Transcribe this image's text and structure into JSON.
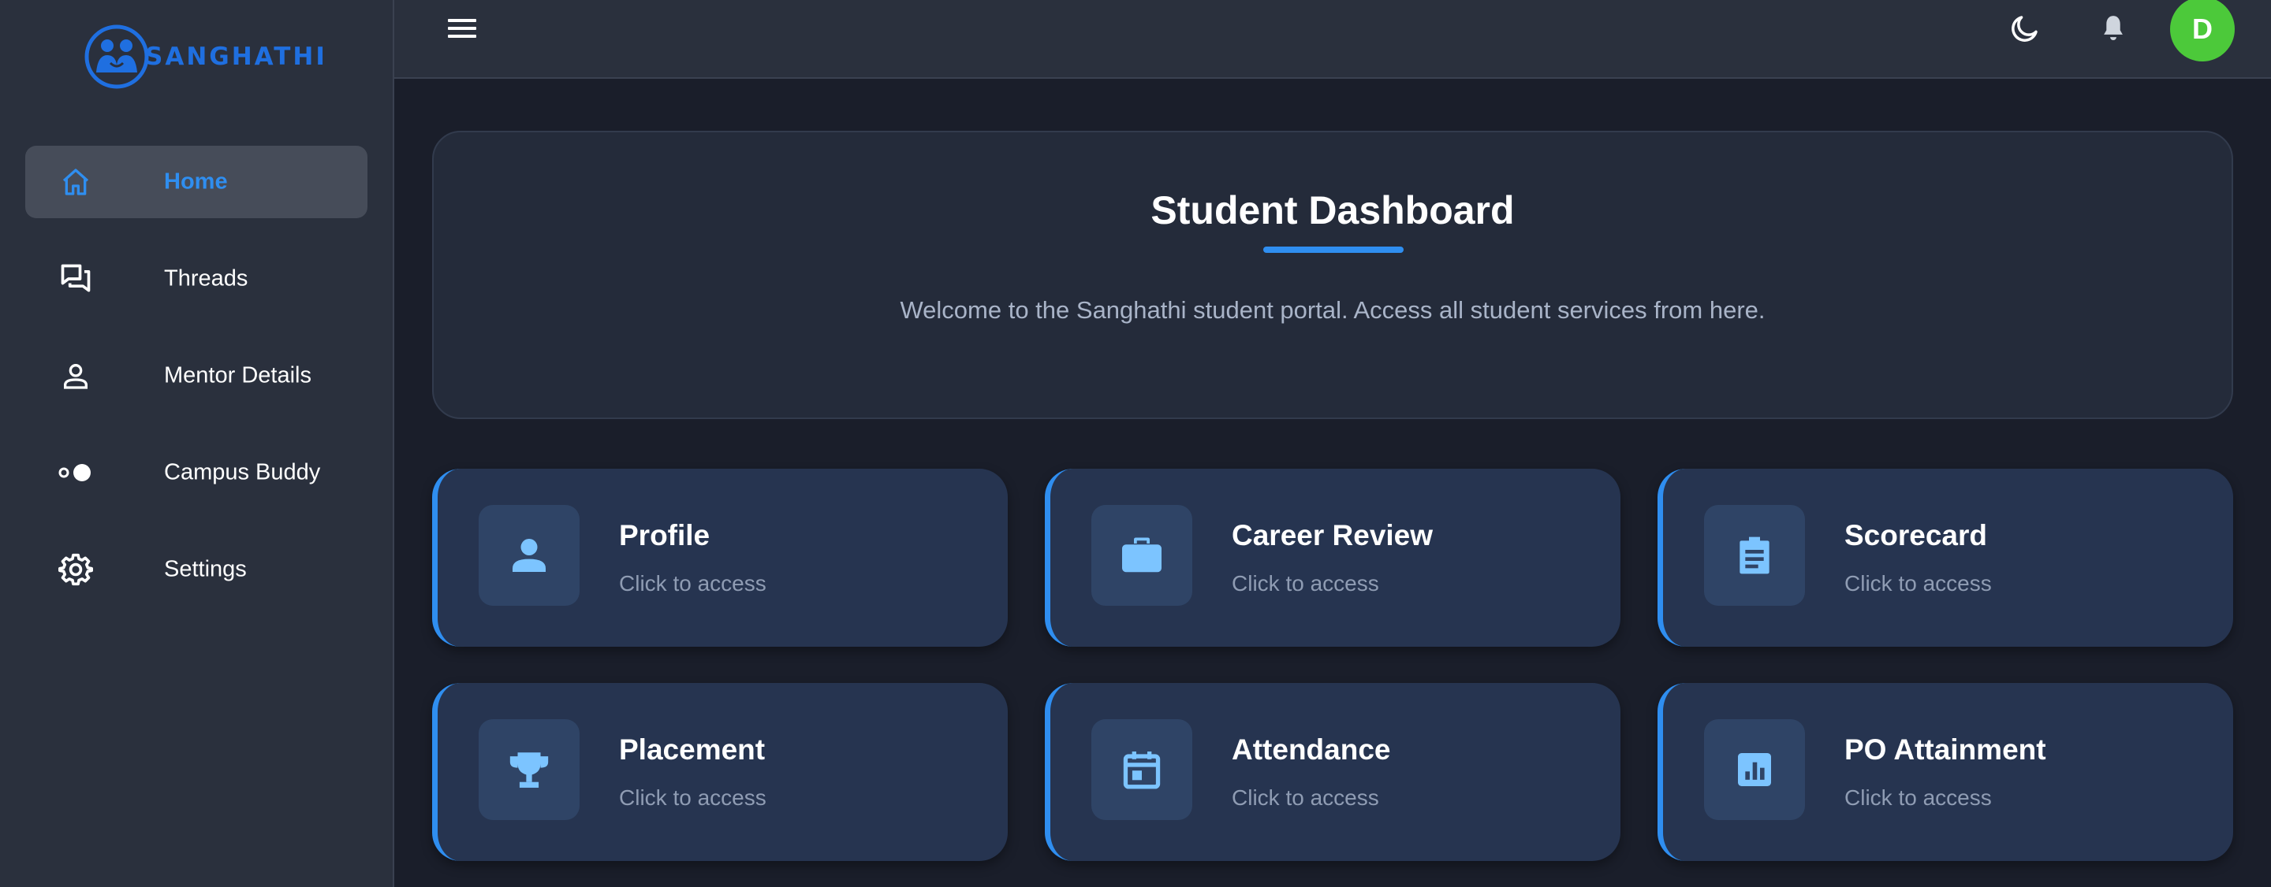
{
  "brand": {
    "name": "SANGHATHI",
    "logo_icon": "people-logo-icon",
    "color": "#1f6fe0"
  },
  "sidebar": {
    "items": [
      {
        "label": "Home",
        "icon": "home-icon",
        "active": true
      },
      {
        "label": "Threads",
        "icon": "chat-bubbles-icon",
        "active": false
      },
      {
        "label": "Mentor Details",
        "icon": "person-icon",
        "active": false
      },
      {
        "label": "Campus Buddy",
        "icon": "toggle-dots-icon",
        "active": false
      },
      {
        "label": "Settings",
        "icon": "gear-icon",
        "active": false
      }
    ]
  },
  "topbar": {
    "menu_icon": "hamburger-menu-icon",
    "theme_icon": "moon-icon",
    "notification_icon": "bell-icon",
    "avatar_initial": "D",
    "avatar_color": "#4cc93a"
  },
  "welcome": {
    "title": "Student Dashboard",
    "text": "Welcome to the Sanghathi student portal. Access all student services from here."
  },
  "cards": [
    {
      "title": "Profile",
      "subtitle": "Click to access",
      "icon": "person-icon"
    },
    {
      "title": "Career Review",
      "subtitle": "Click to access",
      "icon": "briefcase-icon"
    },
    {
      "title": "Scorecard",
      "subtitle": "Click to access",
      "icon": "clipboard-icon"
    },
    {
      "title": "Placement",
      "subtitle": "Click to access",
      "icon": "trophy-icon"
    },
    {
      "title": "Attendance",
      "subtitle": "Click to access",
      "icon": "calendar-icon"
    },
    {
      "title": "PO Attainment",
      "subtitle": "Click to access",
      "icon": "bar-chart-icon"
    }
  ],
  "colors": {
    "accent": "#2f8ef0",
    "sidebar_bg": "#2a303d",
    "card_bg": "#263450",
    "card_icon": "#7cc4ff"
  }
}
